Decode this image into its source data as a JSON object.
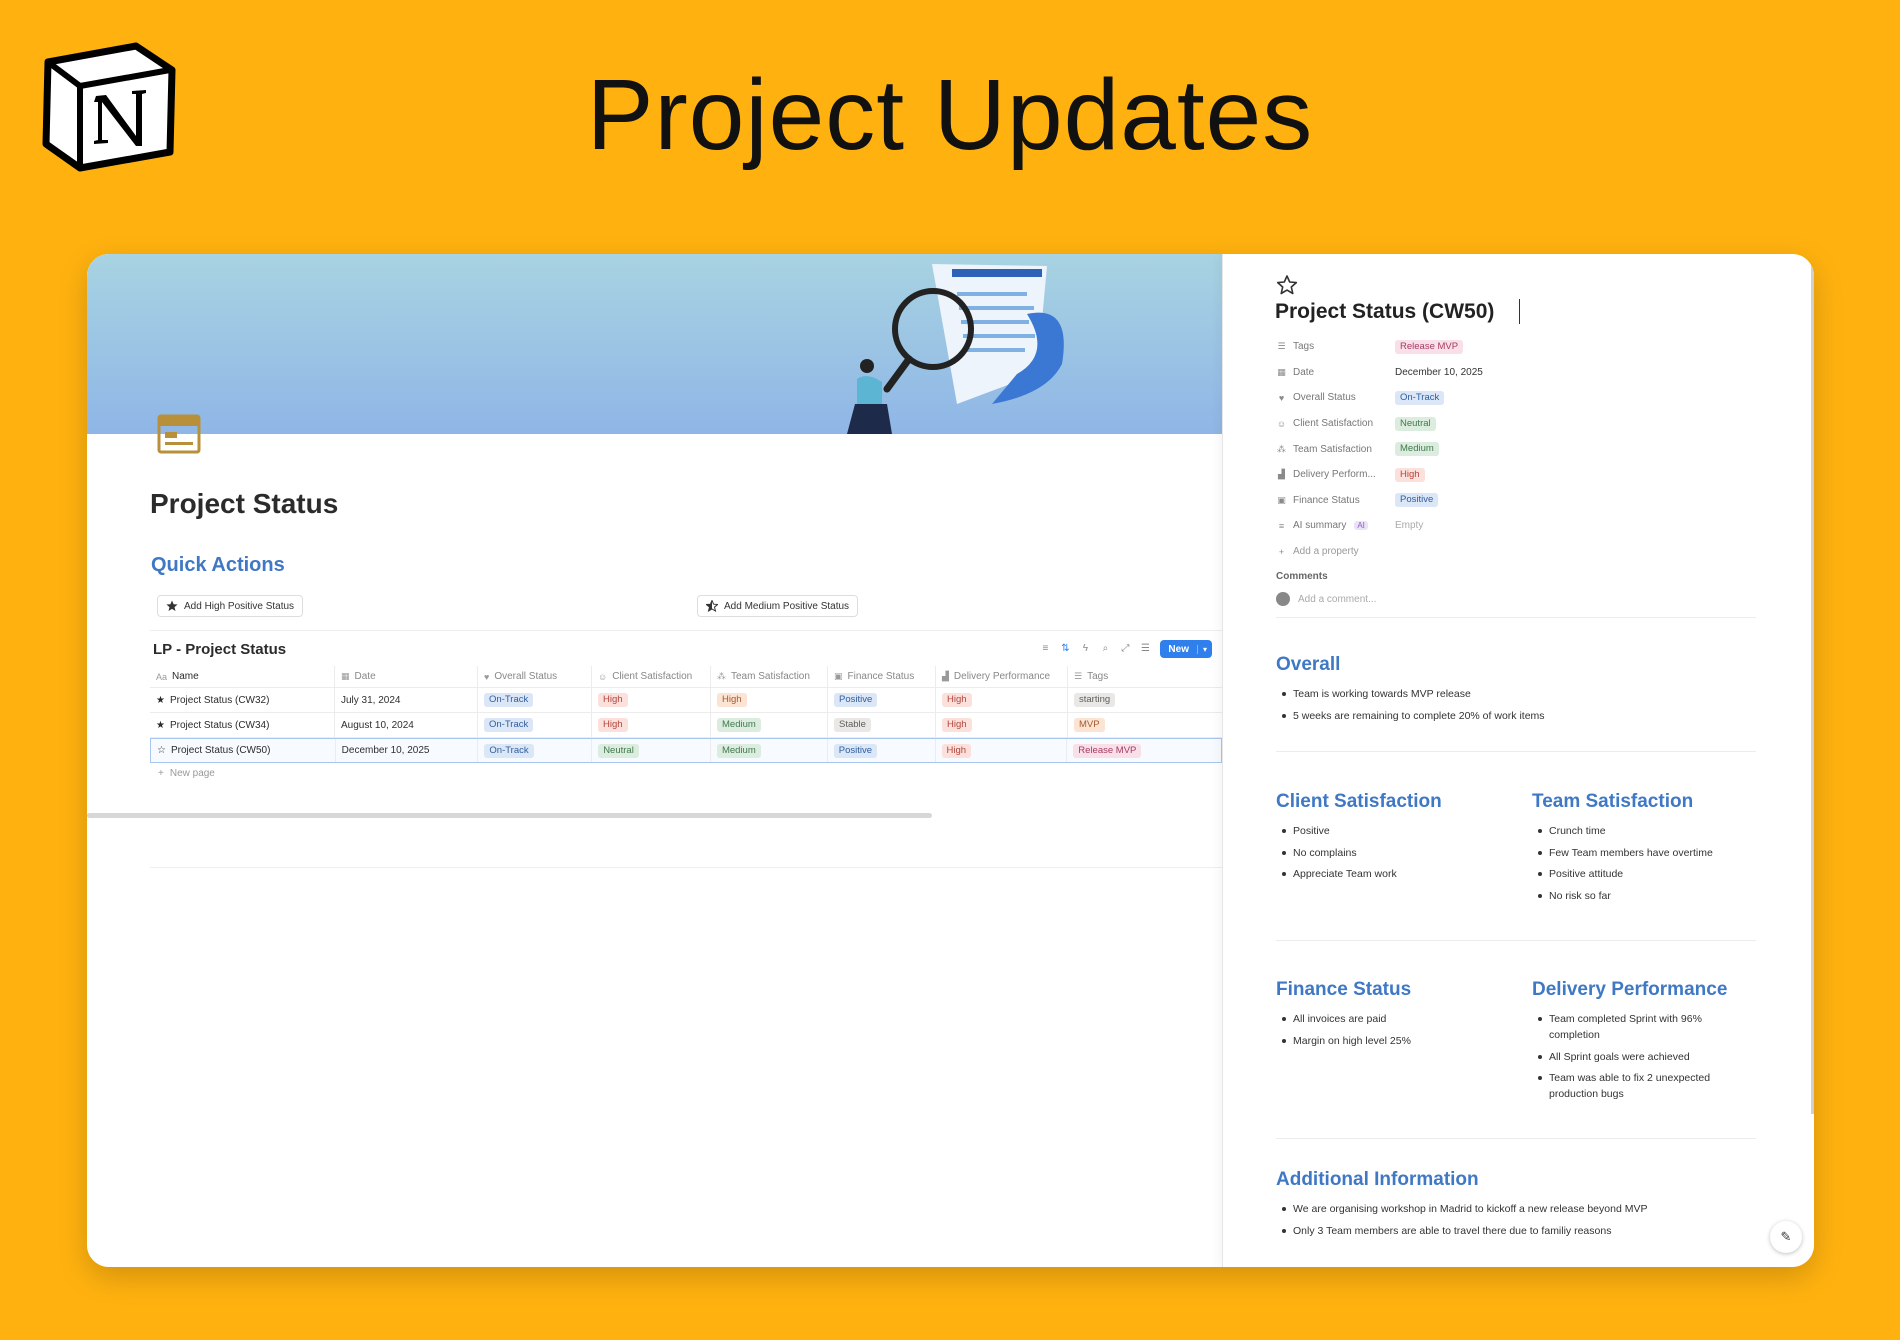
{
  "hero": {
    "title": "Project Updates"
  },
  "page": {
    "title": "Project Status",
    "quick_actions": {
      "heading": "Quick Actions",
      "buttons": [
        "Add High Positive Status",
        "Add Medium Positive Status"
      ]
    },
    "database": {
      "title": "LP - Project Status",
      "new_label": "New",
      "columns": [
        "Name",
        "Date",
        "Overall Status",
        "Client Satisfaction",
        "Team Satisfaction",
        "Finance Status",
        "Delivery Performance",
        "Tags"
      ],
      "rows": [
        {
          "name": "Project Status (CW32)",
          "date": "July 31, 2024",
          "overall": "On-Track",
          "client": "High",
          "team": "High",
          "finance": "Positive",
          "delivery": "High",
          "tags": "starting"
        },
        {
          "name": "Project Status (CW34)",
          "date": "August 10, 2024",
          "overall": "On-Track",
          "client": "High",
          "team": "Medium",
          "finance": "Stable",
          "delivery": "High",
          "tags": "MVP"
        },
        {
          "name": "Project Status (CW50)",
          "date": "December 10, 2025",
          "overall": "On-Track",
          "client": "Neutral",
          "team": "Medium",
          "finance": "Positive",
          "delivery": "High",
          "tags": "Release MVP"
        }
      ],
      "new_page_label": "New page"
    }
  },
  "peek": {
    "title": "Project Status (CW50)",
    "properties": [
      {
        "name": "Tags",
        "value": "Release MVP",
        "icon": "list-icon"
      },
      {
        "name": "Date",
        "value": "December 10, 2025",
        "icon": "calendar-icon"
      },
      {
        "name": "Overall Status",
        "value": "On-Track",
        "icon": "heart-icon"
      },
      {
        "name": "Client Satisfaction",
        "value": "Neutral",
        "icon": "smiley-icon"
      },
      {
        "name": "Team Satisfaction",
        "value": "Medium",
        "icon": "team-icon"
      },
      {
        "name": "Delivery Perform...",
        "value": "High",
        "icon": "chart-icon"
      },
      {
        "name": "Finance Status",
        "value": "Positive",
        "icon": "money-icon"
      },
      {
        "name": "AI summary",
        "value": "Empty",
        "icon": "lines-icon",
        "badge": "AI"
      }
    ],
    "add_property": "Add a property",
    "comments_label": "Comments",
    "comment_placeholder": "Add a comment...",
    "sections": {
      "overall": {
        "title": "Overall",
        "items": [
          "Team is working towards MVP release",
          "5 weeks are remaining to complete 20% of work items"
        ]
      },
      "client": {
        "title": "Client Satisfaction",
        "items": [
          "Positive",
          "No complains",
          "Appreciate Team work"
        ]
      },
      "team": {
        "title": "Team Satisfaction",
        "items": [
          "Crunch time",
          "Few Team members have overtime",
          "Positive attitude",
          "No risk so far"
        ]
      },
      "finance": {
        "title": "Finance Status",
        "items": [
          "All invoices are paid",
          "Margin on high level 25%"
        ]
      },
      "delivery": {
        "title": "Delivery Performance",
        "items": [
          "Team completed Sprint with 96% completion",
          "All Sprint goals were achieved",
          "Team was able to fix 2 unexpected production bugs"
        ]
      },
      "additional": {
        "title": "Additional Information",
        "items": [
          "We are organising workshop in Madrid to kickoff a new release beyond MVP",
          "Only 3 Team members are able to travel there due to familiy reasons"
        ]
      }
    }
  },
  "colors": {
    "background": "#FFB20F",
    "accent": "#3f78c4",
    "new_button": "#2f80ed"
  }
}
